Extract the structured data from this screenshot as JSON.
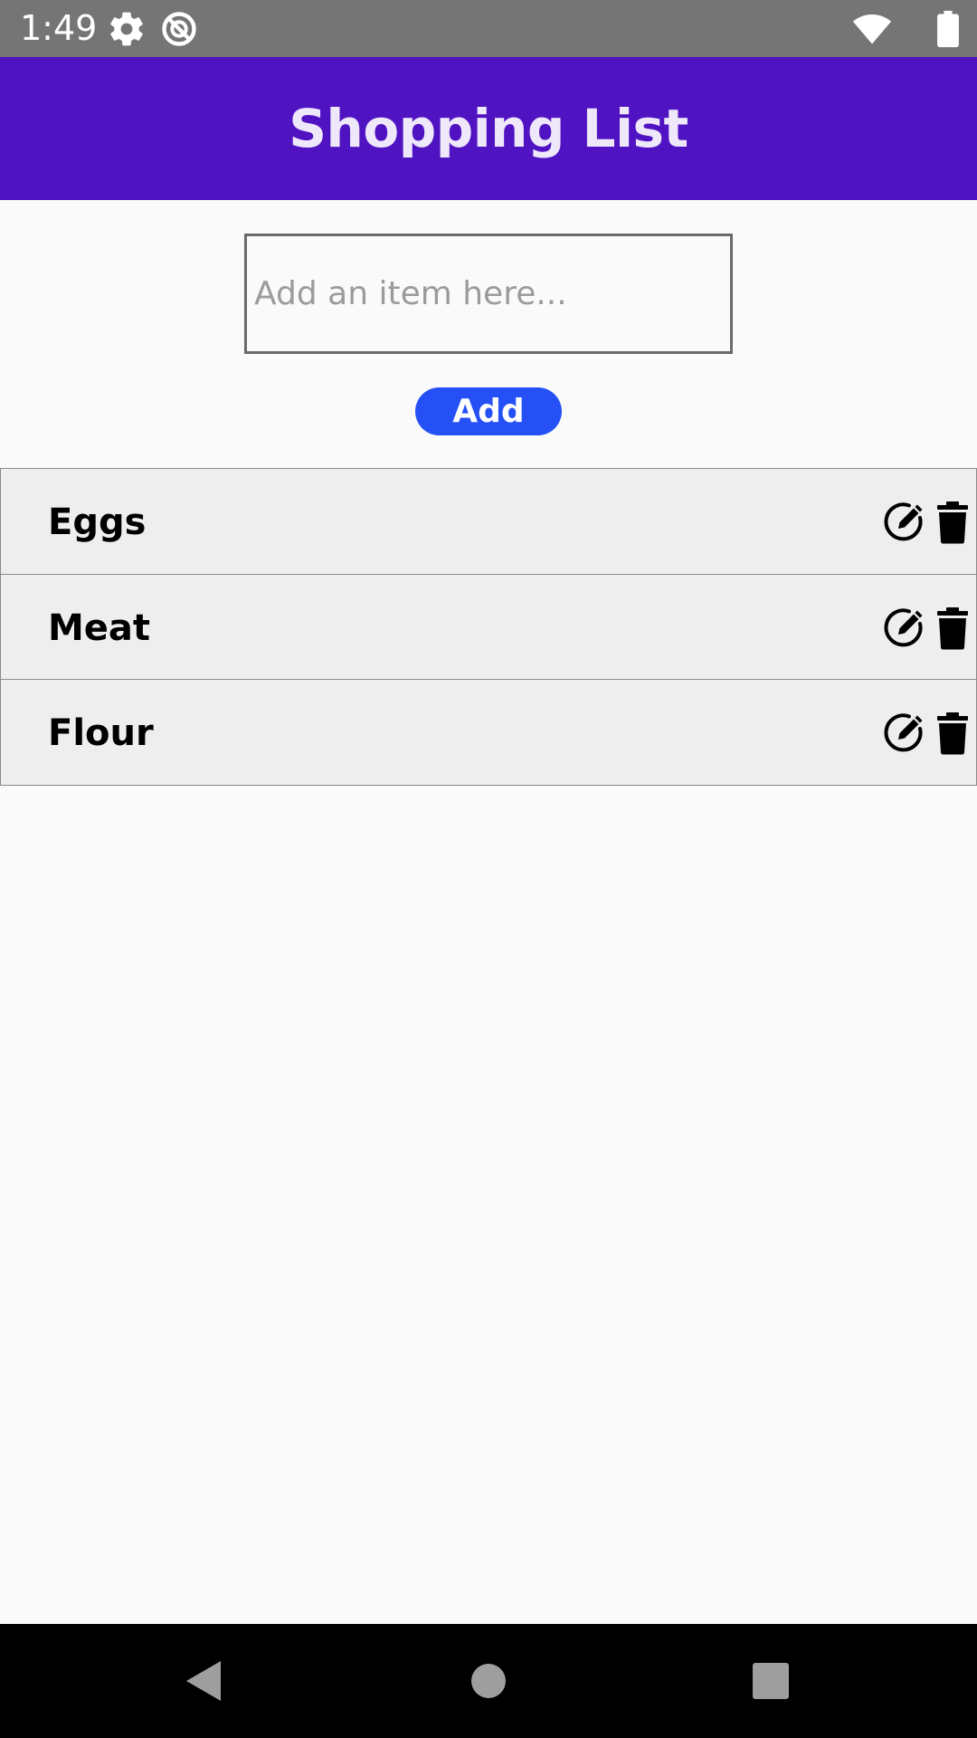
{
  "status_bar": {
    "time": "1:49",
    "icons": [
      "gear-icon",
      "no-sync-icon",
      "wifi-icon",
      "battery-icon"
    ]
  },
  "app_bar": {
    "title": "Shopping List"
  },
  "add_form": {
    "input_value": "",
    "input_placeholder": "Add an item here...",
    "add_label": "Add"
  },
  "items": [
    {
      "label": "Eggs"
    },
    {
      "label": "Meat"
    },
    {
      "label": "Flour"
    }
  ],
  "item_actions": [
    "edit-icon",
    "trash-icon"
  ],
  "nav_bar": {
    "buttons": [
      "back-icon",
      "home-icon",
      "recents-icon"
    ]
  },
  "colors": {
    "status_bar": "#757575",
    "app_bar": "#5013c2",
    "title_text": "#efe8fb",
    "add_button": "#2450f6",
    "list_item_bg": "#eeeeee",
    "page_bg": "#fafafa"
  }
}
